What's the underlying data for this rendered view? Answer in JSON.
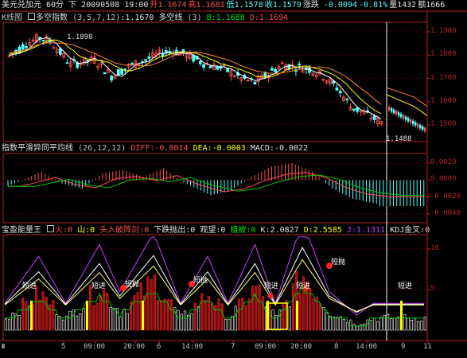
{
  "top_bar": {
    "symbol": "美元兑加元",
    "period": "60分",
    "dir": "下",
    "datetime": "20090508 19:00",
    "open": "开1.1674",
    "high": "高1.1681",
    "low": "低1.1578",
    "close": "收1.1579",
    "fall_label": "涨跌",
    "fall_value": "-0.0094",
    "pct": "-0.81%",
    "volume": "量1432",
    "amount": "额1666"
  },
  "price_panel": {
    "title1": "K线图",
    "title2": "多空指数",
    "params": "(3,5,7,12)",
    "value": ":1.1670",
    "ind2": "多空线",
    "params2": "(3)",
    "b_label": "B:1.1688",
    "d_label": "D:1.1694",
    "max_mark": "1.1898",
    "min_mark": "1.1488",
    "yticks": [
      "1.1900",
      "1.1800",
      "1.1700",
      "1.1600",
      "1.1500"
    ]
  },
  "macd_panel": {
    "title": "指数平滑异同平均线",
    "params": "(26,12,12)",
    "diff": "DIFF:-0.0014",
    "dea": "DEA:-0.0003",
    "macd": "MACD:-0.0022",
    "yticks": [
      "0.0020",
      "0.0000",
      "-0.0020",
      "-0.0040"
    ]
  },
  "energy_panel": {
    "title": "宝盈能量王",
    "fire": "火:0",
    "mountain": "山:0",
    "head": "头入破阵剑:0",
    "drop": "下跌抛出:0",
    "watch": "观望:0",
    "plant": "植被:0",
    "k": "K:2.0827",
    "d": "D:2.5585",
    "j": "J:1.1311",
    "kdj": "KDJ金叉:0",
    "yticks": [
      "10",
      "5"
    ],
    "short_in": "短进",
    "short_out": "短抛"
  },
  "x_axis": {
    "labels": [
      "5",
      "09:00",
      "20:00",
      "6",
      "14:00",
      "7",
      "09:00",
      "20:00",
      "8",
      "14:00",
      "9",
      "11"
    ]
  },
  "colors": {
    "bg": "#000000",
    "grid_red": "#8b0000",
    "axis_red": "#b22222",
    "up_candle": "#ff5050",
    "down_candle": "#54ffff",
    "yellow": "#ffff00",
    "green": "#00c000",
    "magenta": "#c040ff",
    "white": "#ffffff"
  }
}
